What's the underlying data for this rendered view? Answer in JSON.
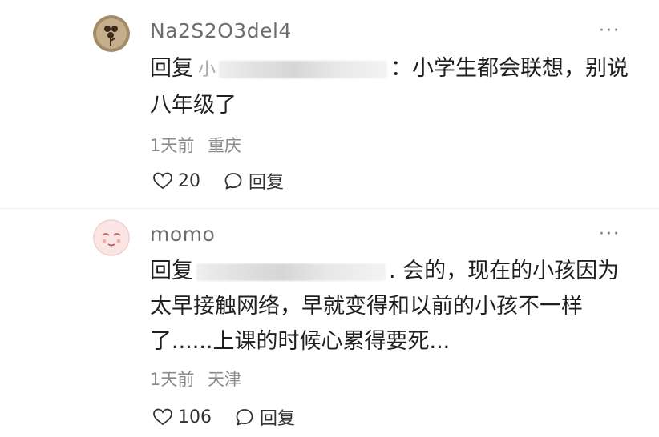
{
  "comments": [
    {
      "username": "Na2S2O3del4",
      "more_label": "···",
      "reply_prefix": "回复",
      "reply_target_hint": "小",
      "content": "：小学生都会联想，别说八年级了",
      "time": "1天前",
      "location": "重庆",
      "likes": "20",
      "reply_label": "回复"
    },
    {
      "username": "momo",
      "more_label": "···",
      "reply_prefix": "回复",
      "reply_target_hint": "",
      "content": ". 会的，现在的小孩因为太早接触网络，早就变得和以前的小孩不一样了......上课的时候心累得要死...",
      "time": "1天前",
      "location": "天津",
      "likes": "106",
      "reply_label": "回复"
    }
  ]
}
